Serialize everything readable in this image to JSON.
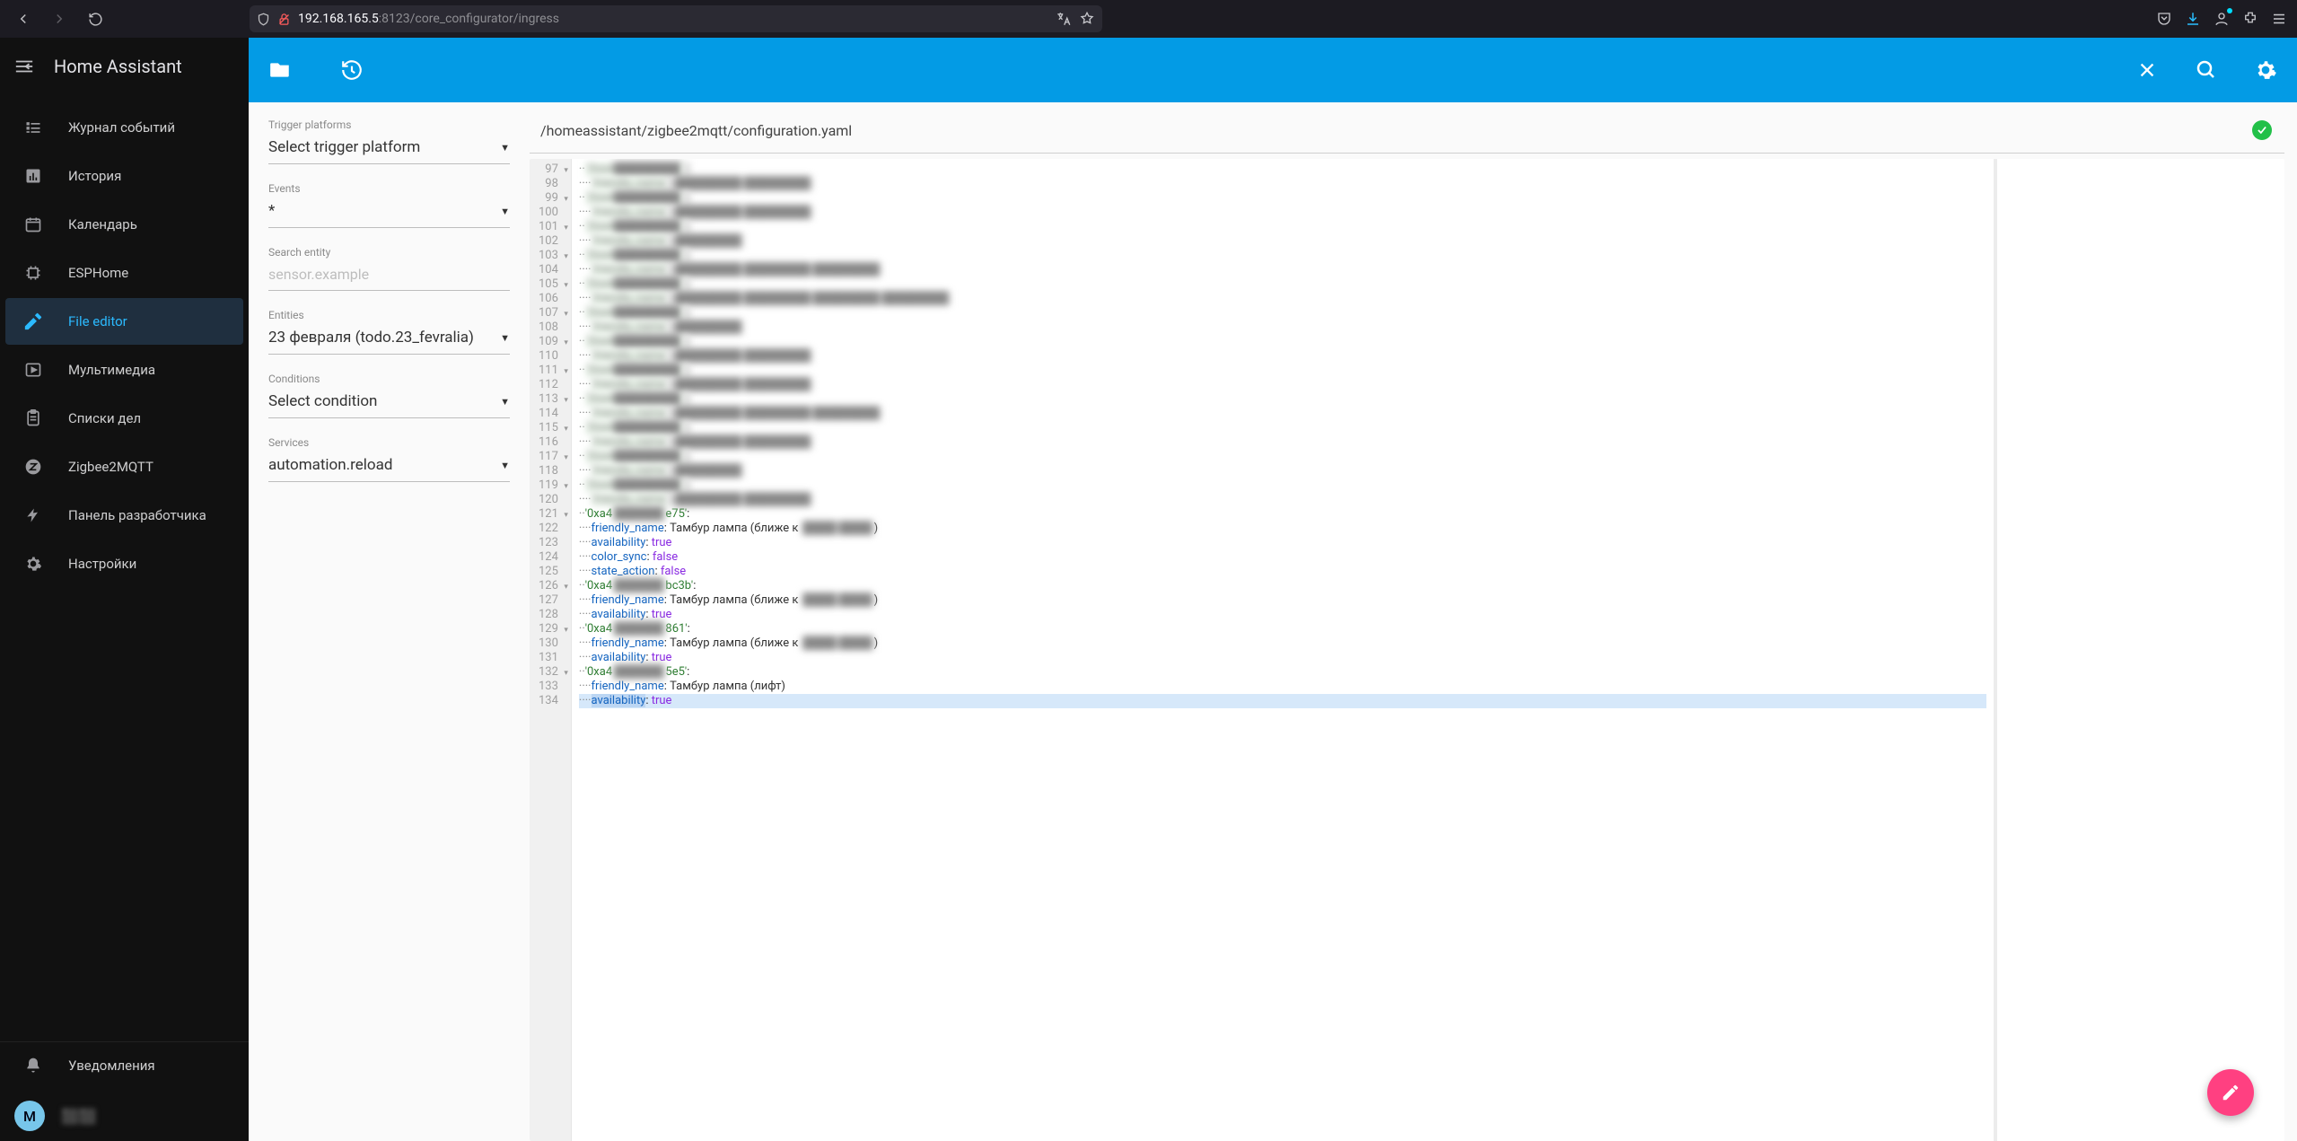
{
  "browser": {
    "url_host": "192.168.165.5",
    "url_port": ":8123",
    "url_path": "/core_configurator/ingress"
  },
  "ha": {
    "title": "Home Assistant",
    "nav": [
      {
        "id": "logbook",
        "label": "Журнал событий"
      },
      {
        "id": "history",
        "label": "История"
      },
      {
        "id": "calendar",
        "label": "Календарь"
      },
      {
        "id": "esphome",
        "label": "ESPHome"
      },
      {
        "id": "file-editor",
        "label": "File editor"
      },
      {
        "id": "media",
        "label": "Мультимедиа"
      },
      {
        "id": "todo",
        "label": "Списки дел"
      },
      {
        "id": "z2m",
        "label": "Zigbee2MQTT"
      },
      {
        "id": "devtools",
        "label": "Панель разработчика"
      },
      {
        "id": "settings",
        "label": "Настройки"
      }
    ],
    "bottom": {
      "notifications": "Уведомления",
      "avatar": "М",
      "username": "⬛⬛"
    }
  },
  "panel": {
    "trigger_label": "Trigger platforms",
    "trigger_value": "Select trigger platform",
    "events_label": "Events",
    "events_value": "*",
    "search_label": "Search entity",
    "search_placeholder": "sensor.example",
    "entities_label": "Entities",
    "entities_value": "23 февраля (todo.23_fevralia)",
    "conditions_label": "Conditions",
    "conditions_value": "Select condition",
    "services_label": "Services",
    "services_value": "automation.reload"
  },
  "editor": {
    "path": "/homeassistant/zigbee2mqtt/configuration.yaml",
    "first_line": 97,
    "lines": [
      {
        "n": 97,
        "fold": true,
        "blur": true,
        "raw": "  '0xa4████████████':"
      },
      {
        "n": 98,
        "blur": true,
        "raw": "    friendly_name: ████████████ ███████████"
      },
      {
        "n": 99,
        "fold": true,
        "blur": true,
        "raw": "  '0xa4████████████':"
      },
      {
        "n": 100,
        "blur": true,
        "raw": "    friendly_name: ████████████ ████"
      },
      {
        "n": 101,
        "fold": true,
        "blur": true,
        "raw": "  '0xa4████████████':"
      },
      {
        "n": 102,
        "blur": true,
        "raw": "    friendly_name: ████████"
      },
      {
        "n": 103,
        "fold": true,
        "blur": true,
        "raw": "  '0xa4████████████':"
      },
      {
        "n": 104,
        "blur": true,
        "raw": "    friendly_name: ████████ ████████████ ████"
      },
      {
        "n": 105,
        "fold": true,
        "blur": true,
        "raw": "  '0xa4████████████':"
      },
      {
        "n": 106,
        "blur": true,
        "raw": "    friendly_name: ████████████ ████ ████████ ████"
      },
      {
        "n": 107,
        "fold": true,
        "blur": true,
        "raw": "  '0xa4████████████':"
      },
      {
        "n": 108,
        "blur": true,
        "raw": "    friendly_name: ████████"
      },
      {
        "n": 109,
        "fold": true,
        "blur": true,
        "raw": "  '0xa4████████████':"
      },
      {
        "n": 110,
        "blur": true,
        "raw": "    friendly_name: ████████ ████████"
      },
      {
        "n": 111,
        "fold": true,
        "blur": true,
        "raw": "  '0xa4████████████':"
      },
      {
        "n": 112,
        "blur": true,
        "raw": "    friendly_name: ████████ ████████"
      },
      {
        "n": 113,
        "fold": true,
        "blur": true,
        "raw": "  '0xa4████████████':"
      },
      {
        "n": 114,
        "blur": true,
        "raw": "    friendly_name: ████████████ ████████ ████"
      },
      {
        "n": 115,
        "fold": true,
        "blur": true,
        "raw": "  '0xa4████████████':"
      },
      {
        "n": 116,
        "blur": true,
        "raw": "    friendly_name: ████████ ████"
      },
      {
        "n": 117,
        "fold": true,
        "blur": true,
        "raw": "  '0xa4████████████':"
      },
      {
        "n": 118,
        "blur": true,
        "raw": "    friendly_name: ████████"
      },
      {
        "n": 119,
        "fold": true,
        "blur": true,
        "raw": "  '0xa4████████████':"
      },
      {
        "n": 120,
        "blur": true,
        "raw": "    friendly_name: ████████ ████"
      },
      {
        "n": 121,
        "fold": true,
        "raw": "  '0xa4██████████e75':",
        "key_start": true
      },
      {
        "n": 122,
        "raw": "    friendly_name: Тамбур лампа (ближе к ████ ████)",
        "blur_tail": true
      },
      {
        "n": 123,
        "raw": "    availability: true",
        "bool": "true"
      },
      {
        "n": 124,
        "raw": "    color_sync: false",
        "bool": "false"
      },
      {
        "n": 125,
        "raw": "    state_action: false",
        "bool": "false"
      },
      {
        "n": 126,
        "fold": true,
        "raw": "  '0xa4██████████bc3b':",
        "key_start": true
      },
      {
        "n": 127,
        "raw": "    friendly_name: Тамбур лампа (ближе к ████ ████)",
        "blur_tail": true
      },
      {
        "n": 128,
        "raw": "    availability: true",
        "bool": "true"
      },
      {
        "n": 129,
        "fold": true,
        "raw": "  '0xa4██████████861':",
        "key_start": true
      },
      {
        "n": 130,
        "raw": "    friendly_name: Тамбур лампа (ближе к ████ ████)",
        "blur_tail": true
      },
      {
        "n": 131,
        "raw": "    availability: true",
        "bool": "true"
      },
      {
        "n": 132,
        "fold": true,
        "raw": "  '0xa4██████████5e5':",
        "key_start": true
      },
      {
        "n": 133,
        "raw": "    friendly_name: Тамбур лампа (лифт)"
      },
      {
        "n": 134,
        "raw": "    availability: true",
        "bool": "true",
        "hl": true
      }
    ]
  }
}
